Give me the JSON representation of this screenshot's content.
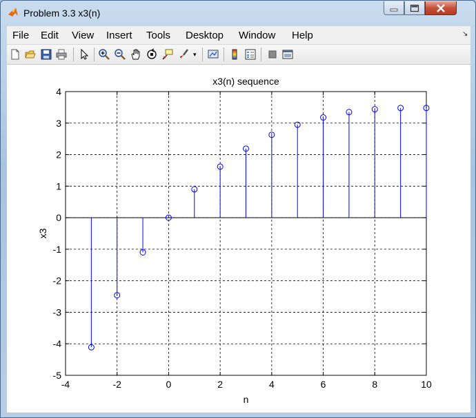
{
  "window": {
    "title": "Problem 3.3 x3(n)",
    "controls": {
      "minimize": "minimize",
      "maximize": "maximize",
      "close": "close"
    }
  },
  "menubar": {
    "items": [
      "File",
      "Edit",
      "View",
      "Insert",
      "Tools",
      "Desktop",
      "Window",
      "Help"
    ]
  },
  "toolbar": {
    "icons": [
      "new-figure-icon",
      "open-file-icon",
      "save-icon",
      "print-icon",
      "select-arrow-icon",
      "zoom-in-icon",
      "zoom-out-icon",
      "pan-hand-icon",
      "rotate-3d-icon",
      "data-cursor-icon",
      "brush-icon",
      "brush-dropdown-icon",
      "link-plot-icon",
      "colorbar-icon",
      "legend-icon",
      "hide-plot-tools-icon",
      "show-plot-tools-icon"
    ]
  },
  "colors": {
    "stem": "#0000ff",
    "grid": "#000000",
    "axes": "#000000"
  },
  "chart_data": {
    "type": "stem",
    "title": "x3(n) sequence",
    "xlabel": "n",
    "ylabel": "x3",
    "xlim": [
      -4,
      10
    ],
    "ylim": [
      -5,
      4
    ],
    "xticks": [
      -4,
      -2,
      0,
      2,
      4,
      6,
      8,
      10
    ],
    "yticks": [
      -5,
      -4,
      -3,
      -2,
      -1,
      0,
      1,
      2,
      3,
      4
    ],
    "grid": true,
    "x": [
      -3,
      -2,
      -1,
      0,
      1,
      2,
      3,
      4,
      5,
      6,
      7,
      8,
      9,
      10
    ],
    "y": [
      -4.11,
      -2.46,
      -1.1,
      0.0,
      0.9,
      1.62,
      2.19,
      2.63,
      2.95,
      3.18,
      3.35,
      3.44,
      3.48,
      3.48
    ]
  }
}
